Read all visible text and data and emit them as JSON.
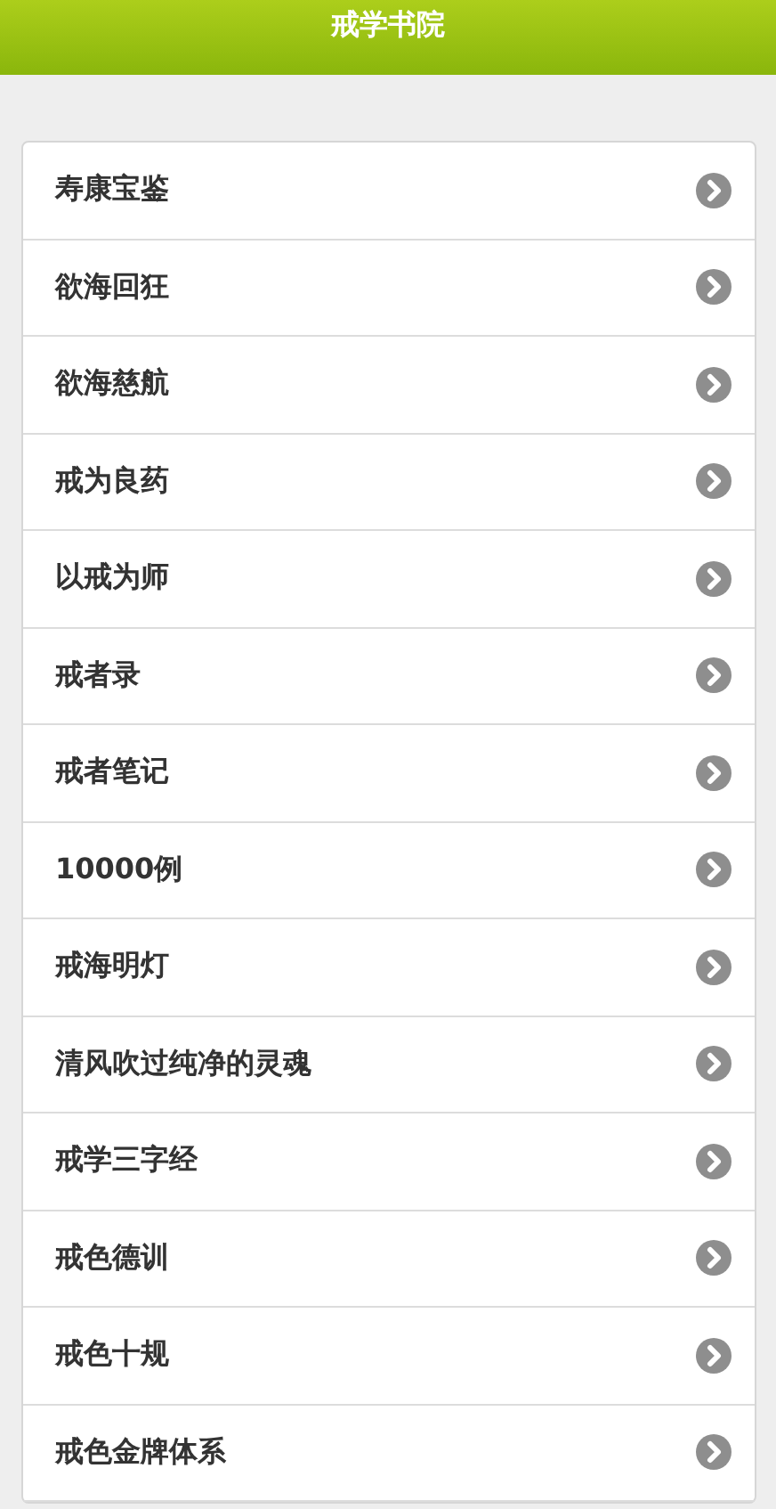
{
  "header": {
    "title": "戒学书院"
  },
  "items": [
    {
      "label": "寿康宝鉴"
    },
    {
      "label": "欲海回狂"
    },
    {
      "label": "欲海慈航"
    },
    {
      "label": "戒为良药"
    },
    {
      "label": "以戒为师"
    },
    {
      "label": "戒者录"
    },
    {
      "label": "戒者笔记"
    },
    {
      "label": "10000例"
    },
    {
      "label": "戒海明灯"
    },
    {
      "label": "清风吹过纯净的灵魂"
    },
    {
      "label": "戒学三字经"
    },
    {
      "label": "戒色德训"
    },
    {
      "label": "戒色十规"
    },
    {
      "label": "戒色金牌体系"
    }
  ]
}
